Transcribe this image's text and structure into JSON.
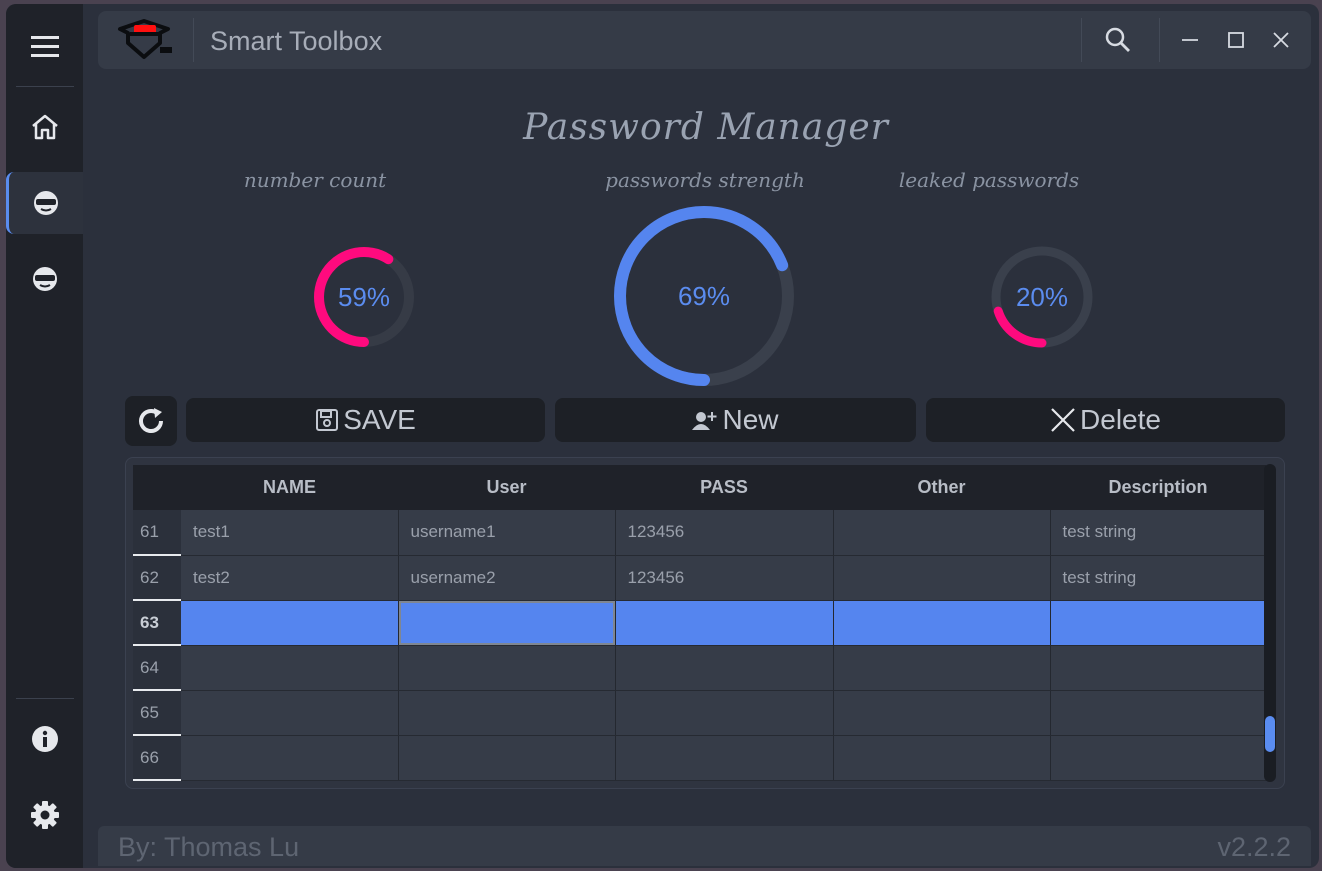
{
  "app": {
    "title": "Smart Toolbox"
  },
  "page": {
    "heading": "Password Manager"
  },
  "gauges": [
    {
      "label": "number count",
      "value": 59,
      "text": "59%",
      "color": "#ff0a7e"
    },
    {
      "label": "passwords strength",
      "value": 69,
      "text": "69%",
      "color": "#5585ef"
    },
    {
      "label": "leaked passwords",
      "value": 20,
      "text": "20%",
      "color": "#ff0a7e"
    }
  ],
  "actions": {
    "save": "SAVE",
    "new": "New",
    "delete": "Delete"
  },
  "table": {
    "columns": [
      "NAME",
      "User",
      "PASS",
      "Other",
      "Description"
    ],
    "rows": [
      {
        "num": "61",
        "cells": [
          "test1",
          "username1",
          "123456",
          "",
          "test string"
        ]
      },
      {
        "num": "62",
        "cells": [
          "test2",
          "username2",
          "123456",
          "",
          "test string"
        ]
      },
      {
        "num": "63",
        "cells": [
          "",
          "",
          "",
          "",
          ""
        ],
        "selected": true
      },
      {
        "num": "64",
        "cells": [
          "",
          "",
          "",
          "",
          ""
        ]
      },
      {
        "num": "65",
        "cells": [
          "",
          "",
          "",
          "",
          ""
        ]
      },
      {
        "num": "66",
        "cells": [
          "",
          "",
          "",
          "",
          ""
        ]
      }
    ]
  },
  "footer": {
    "author": "By: Thomas Lu",
    "version": "v2.2.2"
  },
  "colors": {
    "accent": "#5585ef",
    "pink": "#ff0a7e",
    "track": "#3a404c"
  }
}
